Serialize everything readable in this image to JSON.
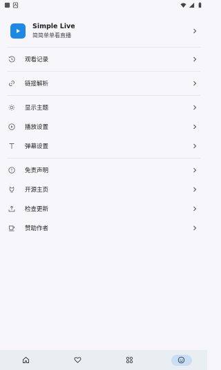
{
  "app": {
    "name": "Simple Live",
    "description": "简简单单看直播"
  },
  "groups": [
    {
      "items": [
        {
          "label": "观看记录",
          "icon": "history-icon"
        }
      ]
    },
    {
      "items": [
        {
          "label": "链接解析",
          "icon": "link-icon"
        }
      ]
    },
    {
      "items": [
        {
          "label": "显示主题",
          "icon": "theme-icon"
        },
        {
          "label": "播放设置",
          "icon": "play-settings-icon"
        },
        {
          "label": "弹幕设置",
          "icon": "danmaku-settings-icon"
        }
      ]
    },
    {
      "items": [
        {
          "label": "免责声明",
          "icon": "info-icon"
        },
        {
          "label": "开源主页",
          "icon": "github-icon"
        },
        {
          "label": "检查更新",
          "icon": "update-icon"
        },
        {
          "label": "赞助作者",
          "icon": "coffee-icon"
        }
      ]
    }
  ],
  "bottom_nav": [
    {
      "name": "home",
      "icon": "home-icon",
      "active": false
    },
    {
      "name": "favorites",
      "icon": "heart-icon",
      "active": false
    },
    {
      "name": "categories",
      "icon": "grid-icon",
      "active": false
    },
    {
      "name": "mine",
      "icon": "smile-icon",
      "active": true
    }
  ],
  "colors": {
    "accent": "#1e88e5",
    "nav_bg": "#e9eef3",
    "nav_active": "#c9def1"
  }
}
